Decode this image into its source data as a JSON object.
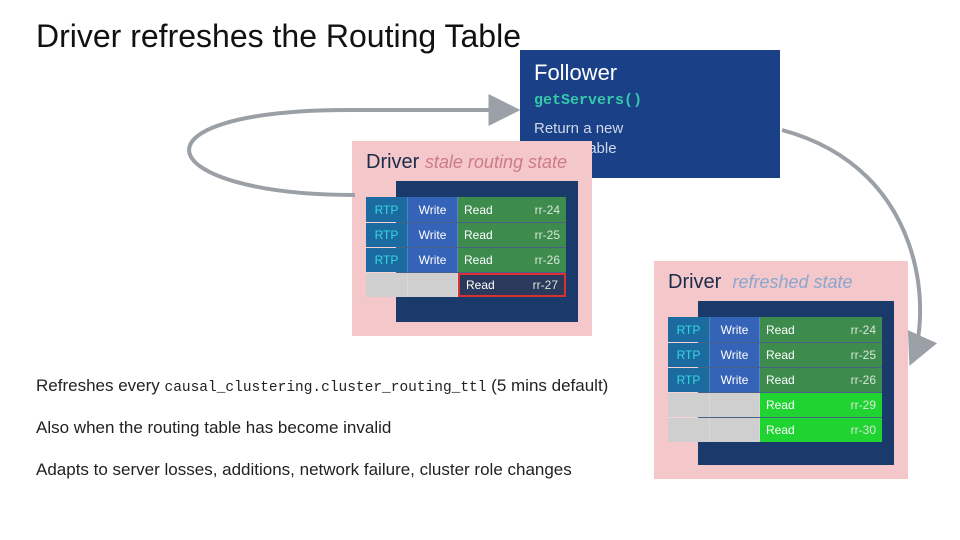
{
  "title": "Driver refreshes the Routing Table",
  "follower": {
    "title": "Follower",
    "method": "getServers()",
    "desc_l1": "Return a new",
    "desc_l2": "routing table"
  },
  "driver_label": "Driver",
  "stale_state_label": "stale routing state",
  "fresh_state_label": "refreshed state",
  "cols": {
    "rtp": "RTP",
    "write": "Write",
    "read": "Read"
  },
  "stale_rows": [
    {
      "rtp": true,
      "write": true,
      "read": "rr-24",
      "kind": "ok"
    },
    {
      "rtp": true,
      "write": true,
      "read": "rr-25",
      "kind": "ok"
    },
    {
      "rtp": true,
      "write": true,
      "read": "rr-26",
      "kind": "ok"
    },
    {
      "rtp": false,
      "write": false,
      "read": "rr-27",
      "kind": "bad"
    }
  ],
  "fresh_rows": [
    {
      "rtp": true,
      "write": true,
      "read": "rr-24",
      "kind": "ok"
    },
    {
      "rtp": true,
      "write": true,
      "read": "rr-25",
      "kind": "ok"
    },
    {
      "rtp": true,
      "write": true,
      "read": "rr-26",
      "kind": "ok"
    },
    {
      "rtp": false,
      "write": false,
      "read": "rr-29",
      "kind": "new"
    },
    {
      "rtp": false,
      "write": false,
      "read": "rr-30",
      "kind": "new"
    }
  ],
  "notes": {
    "line1_a": "Refreshes every ",
    "line1_code": "causal_clustering.cluster_routing_ttl",
    "line1_b": "  (5 mins default)",
    "line2": "Also when the routing table has become invalid",
    "line3": "Adapts to server losses, additions, network failure, cluster role changes"
  },
  "colors": {
    "follower_bg": "#1a4088",
    "panel_bg": "#f4c7cb",
    "inner_bg": "#193a6b",
    "rtp": "#1c6ba0",
    "write": "#3563b7",
    "read_ok": "#3d8c4e",
    "read_bad_border": "#d93030",
    "read_new": "#1fd331",
    "arrow": "#9aa0a6"
  }
}
